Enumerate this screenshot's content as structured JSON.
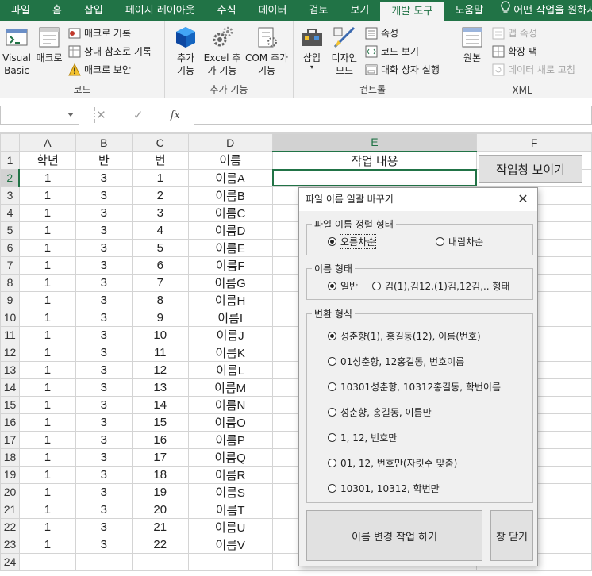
{
  "ribbon_tabs": [
    "파일",
    "홈",
    "삽입",
    "페이지 레이아웃",
    "수식",
    "데이터",
    "검토",
    "보기",
    "개발 도구",
    "도움말"
  ],
  "active_tab": "개발 도구",
  "tell_me": "어떤 작업을 원하시",
  "groups": {
    "code": {
      "label": "코드",
      "visual_basic": "Visual Basic",
      "macro": "매크로",
      "record_macro": "매크로 기록",
      "relative_ref": "상대 참조로 기록",
      "macro_security": "매크로 보안"
    },
    "addins": {
      "label": "추가 기능",
      "addins": "추가 기능",
      "excel_addins": "Excel 추가 기능",
      "com_addins": "COM 추가 기능"
    },
    "controls": {
      "label": "컨트롤",
      "insert": "삽입",
      "design_mode": "디자인 모드",
      "properties": "속성",
      "view_code": "코드 보기",
      "run_dialog": "대화 상자 실행"
    },
    "xml": {
      "label": "XML",
      "source": "원본",
      "map_properties": "맵 속성",
      "expansion_packs": "확장 팩",
      "refresh_data": "데이터 새로 고침"
    }
  },
  "formula_bar": {
    "name_box": "",
    "formula": "",
    "fx": "fx",
    "cancel": "✕",
    "enter": "✓"
  },
  "columns": [
    "A",
    "B",
    "C",
    "D",
    "E",
    "F"
  ],
  "header_row": [
    "학년",
    "반",
    "번",
    "이름",
    "작업 내용",
    ""
  ],
  "rows": [
    [
      "1",
      "3",
      "1",
      "이름A"
    ],
    [
      "1",
      "3",
      "2",
      "이름B"
    ],
    [
      "1",
      "3",
      "3",
      "이름C"
    ],
    [
      "1",
      "3",
      "4",
      "이름D"
    ],
    [
      "1",
      "3",
      "5",
      "이름E"
    ],
    [
      "1",
      "3",
      "6",
      "이름F"
    ],
    [
      "1",
      "3",
      "7",
      "이름G"
    ],
    [
      "1",
      "3",
      "8",
      "이름H"
    ],
    [
      "1",
      "3",
      "9",
      "이름I"
    ],
    [
      "1",
      "3",
      "10",
      "이름J"
    ],
    [
      "1",
      "3",
      "11",
      "이름K"
    ],
    [
      "1",
      "3",
      "12",
      "이름L"
    ],
    [
      "1",
      "3",
      "13",
      "이름M"
    ],
    [
      "1",
      "3",
      "14",
      "이름N"
    ],
    [
      "1",
      "3",
      "15",
      "이름O"
    ],
    [
      "1",
      "3",
      "16",
      "이름P"
    ],
    [
      "1",
      "3",
      "17",
      "이름Q"
    ],
    [
      "1",
      "3",
      "18",
      "이름R"
    ],
    [
      "1",
      "3",
      "19",
      "이름S"
    ],
    [
      "1",
      "3",
      "20",
      "이름T"
    ],
    [
      "1",
      "3",
      "21",
      "이름U"
    ],
    [
      "1",
      "3",
      "22",
      "이름V"
    ]
  ],
  "sheet_button": "작업창 보이기",
  "dialog": {
    "title": "파일 이름 일괄 바꾸기",
    "sort_group": "파일 이름 정렬 형태",
    "sort_asc": "오름차순",
    "sort_desc": "내림차순",
    "sort_selected": "asc",
    "name_group": "이름 형태",
    "name_normal": "일반",
    "name_numbered": "김(1),김12,(1)김,12김,.. 형태",
    "convert_group": "변환 형식",
    "convert_options": [
      "성춘향(1), 홍길동(12),  이름(번호)",
      "01성춘향, 12홍길동, 번호이름",
      "10301성춘향, 10312홍길동, 학번이름",
      "성춘향, 홍길동, 이름만",
      "1, 12, 번호만",
      "01, 12, 번호만(자릿수 맞춤)",
      "10301, 10312, 학번만"
    ],
    "convert_selected": 0,
    "run_button": "이름 변경 작업 하기",
    "close_button": "창 닫기"
  }
}
